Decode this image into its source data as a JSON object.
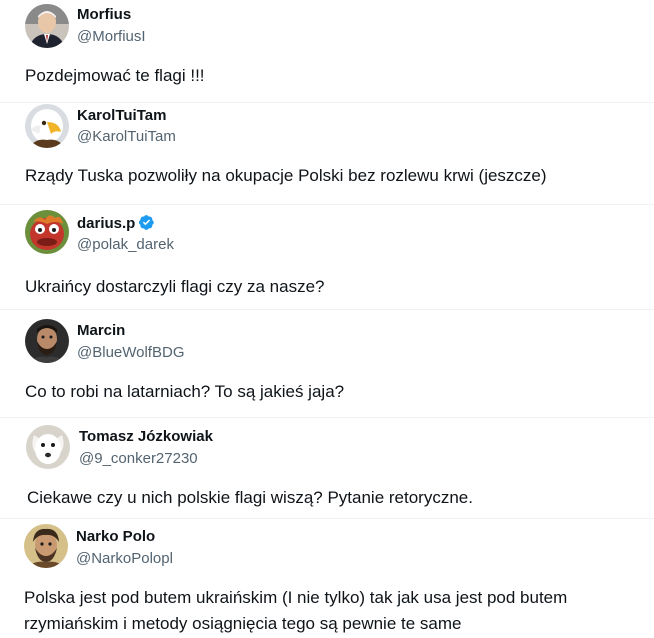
{
  "tweets": [
    {
      "name": "Morfius",
      "handle": "@MorfiusI",
      "text": "Pozdejmować te flagi !!!",
      "avatar_icon": "portrait-man-suit-avatar",
      "verified": false
    },
    {
      "name": "KarolTuiTam",
      "handle": "@KarolTuiTam",
      "text": "Rządy Tuska pozwoliły na okupacje Polski bez rozlewu krwi (jeszcze)",
      "avatar_icon": "bald-eagle-avatar",
      "verified": false
    },
    {
      "name": "darius.p",
      "handle": "@polak_darek",
      "text": "Ukraińcy dostarczyli flagi czy za nasze?",
      "avatar_icon": "red-muppet-avatar",
      "verified": true
    },
    {
      "name": "Marcin",
      "handle": "@BlueWolfBDG",
      "text": "Co to robi na latarniach? To są jakieś jaja?",
      "avatar_icon": "bearded-man-avatar",
      "verified": false
    },
    {
      "name": "Tomasz Józkowiak",
      "handle": "@9_conker27230",
      "text": "Ciekawe czy u nich polskie flagi wiszą? Pytanie retoryczne.",
      "avatar_icon": "white-dog-avatar",
      "verified": false
    },
    {
      "name": "Narko Polo",
      "handle": "@NarkoPolopl",
      "text_line1": "Polska jest pod butem ukraińskim (I nie tylko) tak jak usa jest pod butem",
      "text_line2": "rzymiańskim i metody osiągnięcia tego są pewnie te same",
      "avatar_icon": "illustrated-man-avatar",
      "verified": false
    }
  ],
  "colors": {
    "name": "#0f1419",
    "handle": "#536471",
    "verified": "#1d9bf0",
    "separator": "#eff3f4"
  }
}
